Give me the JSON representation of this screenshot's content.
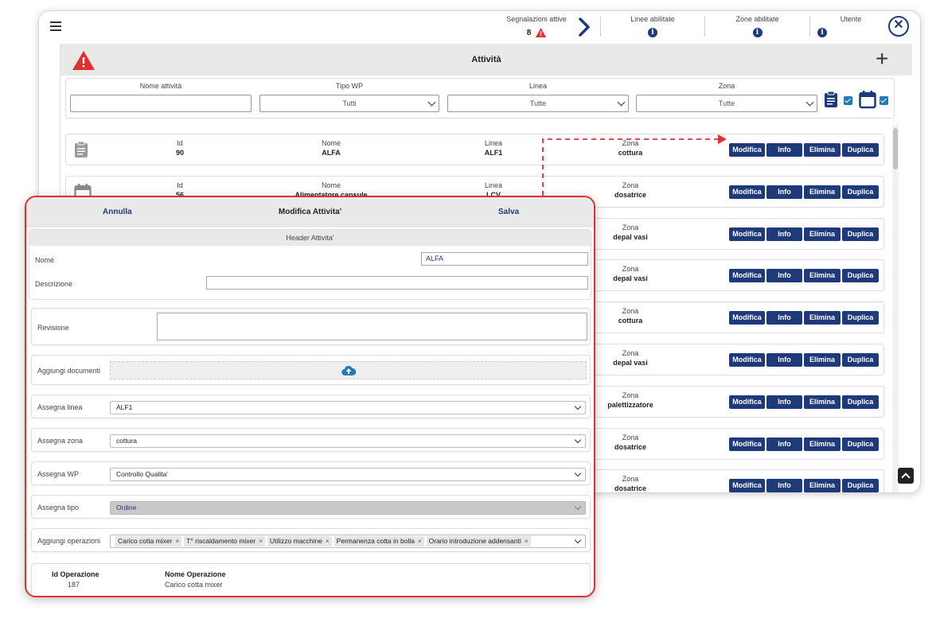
{
  "topbar": {
    "segnalazioni_label": "Segnalazioni attive",
    "segnalazioni_count": "8",
    "linee_label": "Linee abilitate",
    "zone_label": "Zone abilitate",
    "utente_label": "Utente",
    "info_glyph": "i",
    "close_glyph": "✕"
  },
  "panel": {
    "title": "Attività",
    "plus": "+"
  },
  "filters": {
    "nome_label": "Nome attività",
    "tipo_label": "Tipo WP",
    "tipo_value": "Tutti",
    "linea_label": "Linea",
    "linea_value": "Tutte",
    "zona_label": "Zona",
    "zona_value": "Tutte"
  },
  "row_labels": {
    "id": "Id",
    "nome": "Nome",
    "linea": "Linea",
    "zona": "Zona",
    "modifica": "Modifica",
    "info": "Info",
    "elimina": "Elimina",
    "duplica": "Duplica"
  },
  "rows": [
    {
      "id": "90",
      "nome": "ALFA",
      "linea": "ALF1",
      "zona": "cottura",
      "icon": "clipboard-icon"
    },
    {
      "id": "56",
      "nome": "Alimentatore capsule",
      "linea": "LCV",
      "zona": "dosatrice",
      "icon": "calendar-icon"
    },
    {
      "zona": "depal vasi"
    },
    {
      "zona": "depal vasi"
    },
    {
      "zona": "cottura"
    },
    {
      "zona": "depal vasi"
    },
    {
      "zona": "palettizzatore"
    },
    {
      "zona": "dosatrice"
    },
    {
      "zona": "dosatrice"
    }
  ],
  "modal": {
    "annulla": "Annulla",
    "title": "Modifica Attivita'",
    "salva": "Salva",
    "header_section": "Header Attivita'",
    "nome_label": "Nome",
    "nome_value": "ALFA",
    "descrizione_label": "Descrizione",
    "descrizione_value": "",
    "revisione_label": "Revisione",
    "documenti_label": "Aggiungi documenti",
    "linea_label": "Assegna linea",
    "linea_value": "ALF1",
    "zona_label": "Assegna zona",
    "zona_value": "cottura",
    "wp_label": "Assegna WP",
    "wp_value": "Controllo Qualita'",
    "tipo_label": "Assegna tipo",
    "tipo_value": "Ordine",
    "operazioni_label": "Aggiungi operazioni",
    "operazioni": [
      "Carico cotta mixer",
      "T° riscaldamento mixer",
      "Utilizzo macchine",
      "Permanenza cotta in bolla",
      "Orario introduzione addensanti"
    ],
    "tag_remove": "×",
    "op_table": {
      "id_header": "Id Operazione",
      "nome_header": "Nome Operazione",
      "rows": [
        {
          "id": "187",
          "nome": "Carico cotta mixer"
        }
      ]
    }
  },
  "colors": {
    "accent_navy": "#1e3a7a",
    "alert_red": "#e03131",
    "checkbox_blue": "#1f7ab8"
  }
}
